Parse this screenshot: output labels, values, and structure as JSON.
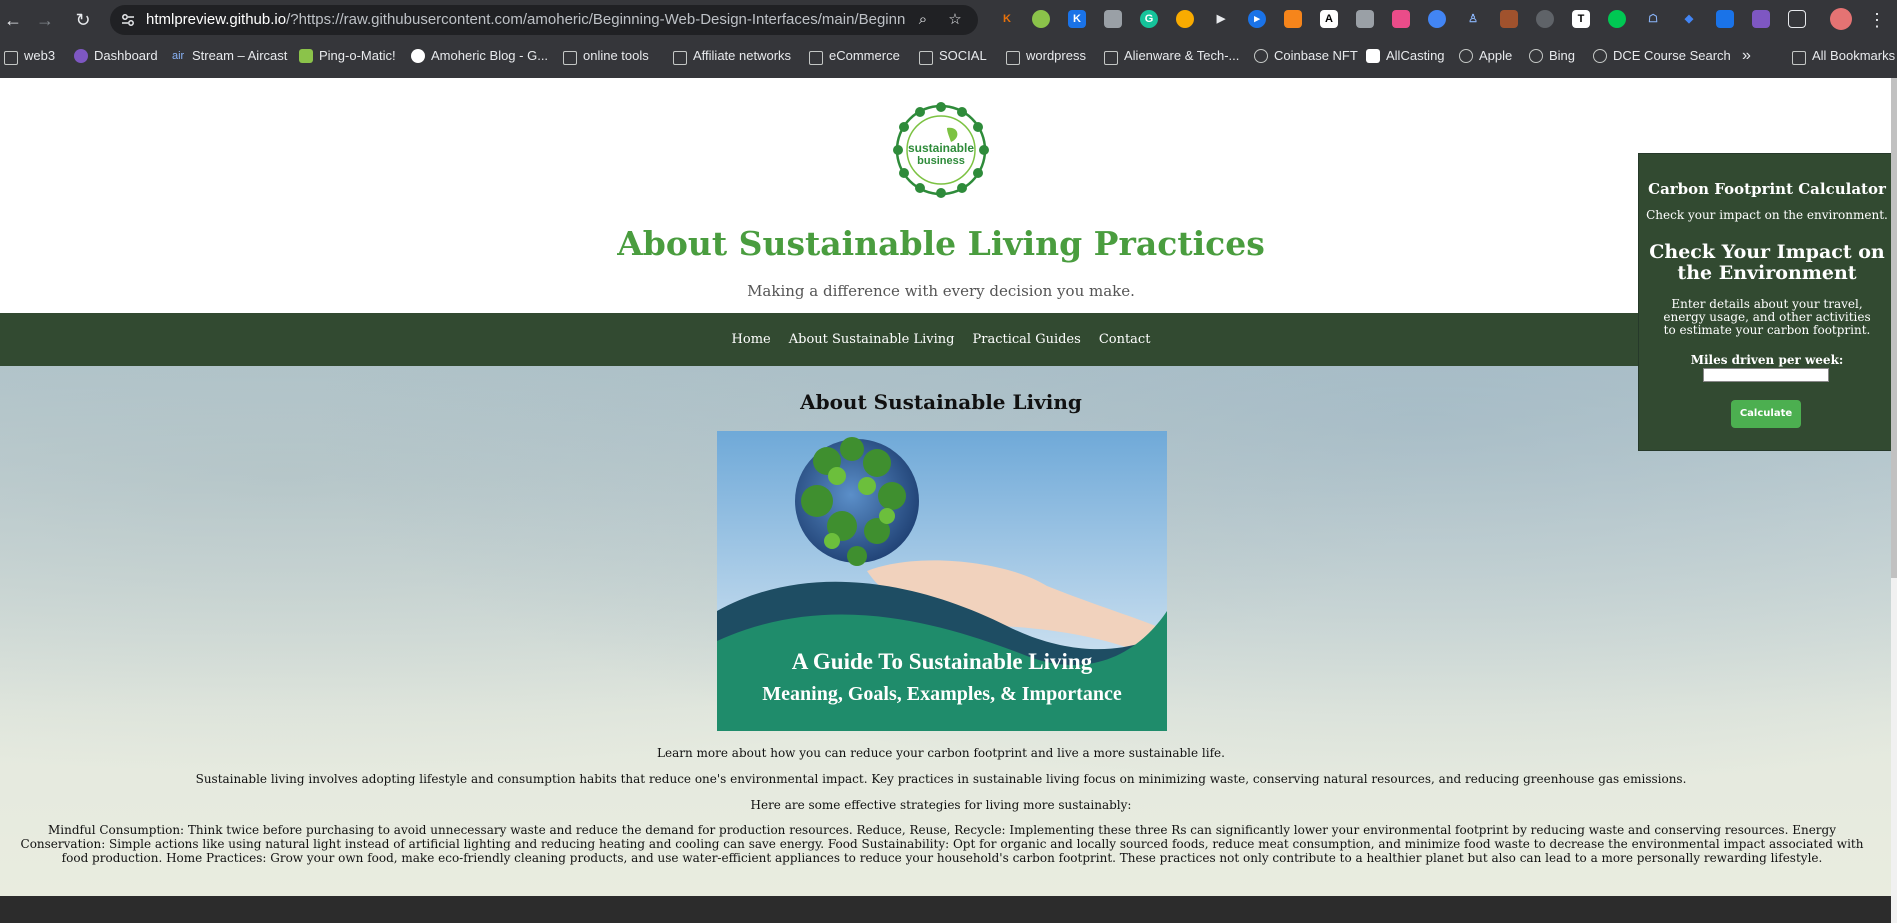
{
  "browser": {
    "url_host": "htmlpreview.github.io",
    "url_rest": "/?https://raw.githubusercontent.com/amoheric/Beginning-Web-Design-Interfaces/main/Beginning-...",
    "bookmarks": [
      "web3",
      "Dashboard",
      "Stream – Aircast",
      "Ping-o-Matic!",
      "Amoheric Blog - G...",
      "online tools",
      "Affiliate networks",
      "eCommerce",
      "SOCIAL",
      "wordpress",
      "Alienware & Tech-...",
      "Coinbase NFT",
      "AllCasting",
      "Apple",
      "Bing",
      "DCE Course Search",
      "All Bookmarks"
    ],
    "more_bookmarks": "»"
  },
  "logo": {
    "text_1": "sustainable",
    "text_2": "business"
  },
  "header": {
    "title": "About Sustainable Living Practices",
    "tagline": "Making a difference with every decision you make."
  },
  "nav": [
    "Home",
    "About Sustainable Living",
    "Practical Guides",
    "Contact"
  ],
  "main": {
    "section_title": "About Sustainable Living",
    "hero_caption_1": "A Guide To Sustainable Living",
    "hero_caption_2": "Meaning, Goals, Examples, & Importance",
    "p1": "Learn more about how you can reduce your carbon footprint and live a more sustainable life.",
    "p2": "Sustainable living involves adopting lifestyle and consumption habits that reduce one's environmental impact. Key practices in sustainable living focus on minimizing waste, conserving natural resources, and reducing greenhouse gas emissions.",
    "p3": "Here are some effective strategies for living more sustainably:",
    "p4": "Mindful Consumption: Think twice before purchasing to avoid unnecessary waste and reduce the demand for production resources. Reduce, Reuse, Recycle: Implementing these three Rs can significantly lower your environmental footprint by reducing waste and conserving resources. Energy Conservation: Simple actions like using natural light instead of artificial lighting and reducing heating and cooling can save energy. Food Sustainability: Opt for organic and locally sourced foods, reduce meat consumption, and minimize food waste to decrease the environmental impact associated with food production. Home Practices: Grow your own food, make eco-friendly cleaning products, and use water-efficient appliances to reduce your household's carbon footprint. These practices not only contribute to a healthier planet but also can lead to a more personally rewarding lifestyle."
  },
  "calculator": {
    "title": "Carbon Footprint Calculator",
    "subtitle": "Check your impact on the environment.",
    "heading": "Check Your Impact on the Environment",
    "description": "Enter details about your travel, energy usage, and other activities to estimate your carbon footprint.",
    "miles_label": "Miles driven per week:",
    "miles_value": "",
    "button_label": "Calculate"
  },
  "colors": {
    "brand_green": "#4a9d3f",
    "nav_bg": "#324a31",
    "button_green": "#4caf50"
  }
}
